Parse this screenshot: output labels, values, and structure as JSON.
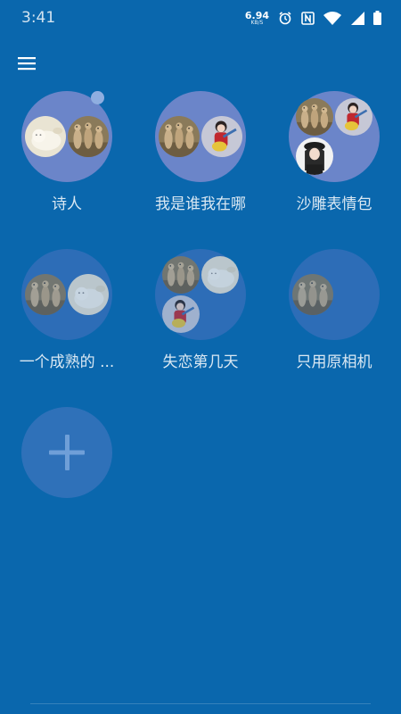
{
  "status_bar": {
    "time": "3:41",
    "net_speed_value": "6.94",
    "net_speed_unit": "KB/S",
    "icons": [
      "alarm-icon",
      "nfc-icon",
      "wifi-icon",
      "signal-icon",
      "battery-icon"
    ]
  },
  "toolbar": {
    "menu_icon": "hamburger-menu-icon"
  },
  "groups": [
    {
      "label": "诗人",
      "avatars": [
        "white-cat-photo",
        "meerkats-photo"
      ],
      "has_unread": true
    },
    {
      "label": "我是谁我在哪",
      "avatars": [
        "meerkats-photo",
        "guitar-girl-photo"
      ]
    },
    {
      "label": "沙雕表情包",
      "avatars": [
        "meerkats-photo",
        "guitar-girl-photo",
        "girl-with-hat-photo"
      ]
    },
    {
      "label": "一个成熟的 ...",
      "avatars": [
        "meerkats-photo",
        "white-cat-photo"
      ]
    },
    {
      "label": "失恋第几天",
      "avatars": [
        "meerkats-photo",
        "white-cat-photo",
        "guitar-girl-photo"
      ]
    },
    {
      "label": "只用原相机",
      "avatars": [
        "meerkats-photo"
      ]
    }
  ],
  "add_group": {
    "icon": "plus-icon"
  },
  "colors": {
    "background": "#0a67ad",
    "bubble_active": "#6b85c9",
    "bubble_dim": "#2d6db7",
    "unread_dot": "#8faee0"
  }
}
